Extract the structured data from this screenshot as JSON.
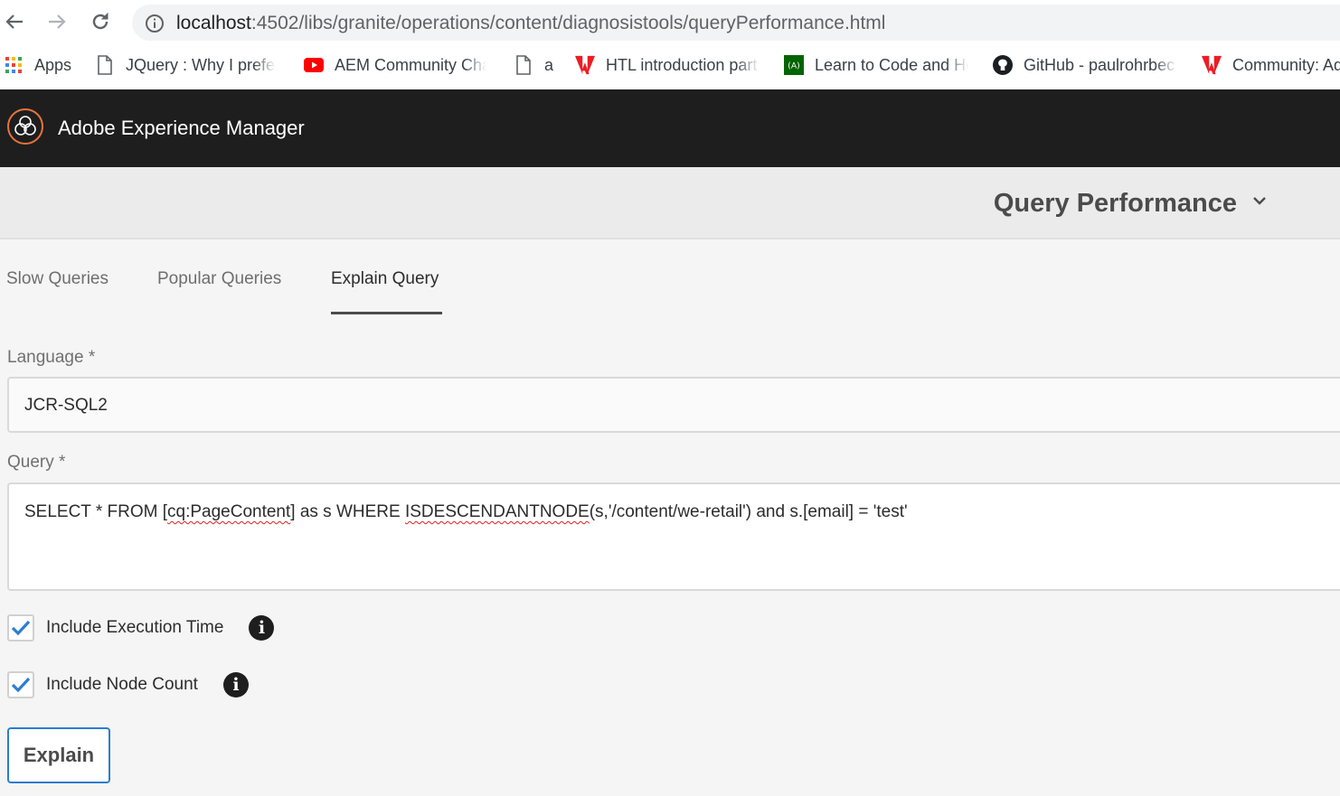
{
  "browser": {
    "url_host": "localhost",
    "url_path": ":4502/libs/granite/operations/content/diagnosistools/queryPerformance.html",
    "bookmarks": [
      {
        "label": "Apps",
        "icon": "apps-grid-icon"
      },
      {
        "label": "JQuery : Why I prefer",
        "icon": "page-icon"
      },
      {
        "label": "AEM Community Cha",
        "icon": "youtube-icon"
      },
      {
        "label": "a",
        "icon": "page-icon"
      },
      {
        "label": "HTL introduction part",
        "icon": "adobe-icon"
      },
      {
        "label": "Learn to Code and He",
        "icon": "freecodecamp-icon"
      },
      {
        "label": "GitHub - paulrohrbec",
        "icon": "github-icon"
      },
      {
        "label": "Community: Ad",
        "icon": "adobe-icon"
      }
    ]
  },
  "header": {
    "app_title": "Adobe Experience Manager"
  },
  "page": {
    "title": "Query Performance"
  },
  "tabs": [
    {
      "label": "Slow Queries",
      "active": false
    },
    {
      "label": "Popular Queries",
      "active": false
    },
    {
      "label": "Explain Query",
      "active": true
    }
  ],
  "form": {
    "language_label": "Language *",
    "language_value": "JCR-SQL2",
    "query_label": "Query *",
    "query_parts": {
      "p1": "SELECT * FROM [",
      "p2": "cq:PageContent",
      "p3": "] as s WHERE ",
      "p4": "ISDESCENDANTNODE",
      "p5": "(s,'/content/we-retail') and s.[email] = 'test'"
    },
    "include_execution_time_label": "Include Execution Time",
    "include_execution_time_checked": true,
    "include_node_count_label": "Include Node Count",
    "include_node_count_checked": true,
    "explain_button": "Explain"
  },
  "colors": {
    "accent": "#2b7dd1",
    "header_bg": "#1e1e1e",
    "logo": "#e8733b"
  }
}
